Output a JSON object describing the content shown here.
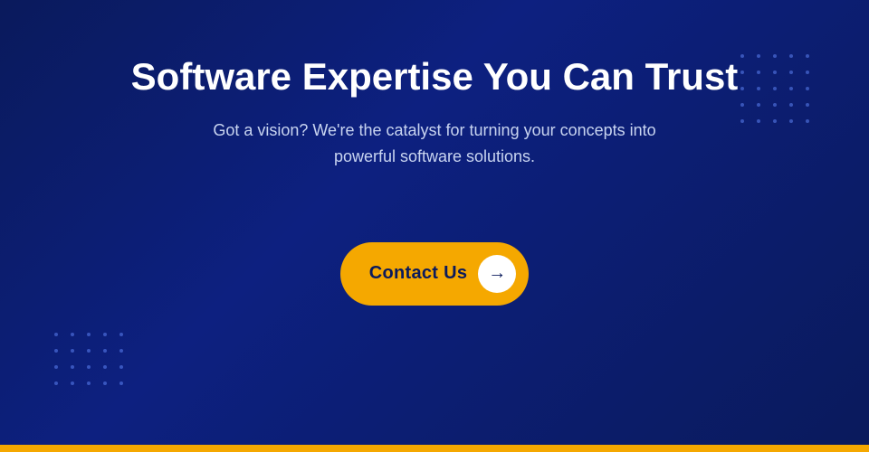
{
  "hero": {
    "title": "Software Expertise You Can Trust",
    "subtitle": "Got a vision? We're the catalyst for turning your concepts into powerful software solutions.",
    "cta_label": "Contact Us",
    "cta_arrow": "→"
  },
  "colors": {
    "background": "#0a1a5c",
    "accent": "#f5a800",
    "text_primary": "#ffffff",
    "text_secondary": "#c8d4f0"
  }
}
